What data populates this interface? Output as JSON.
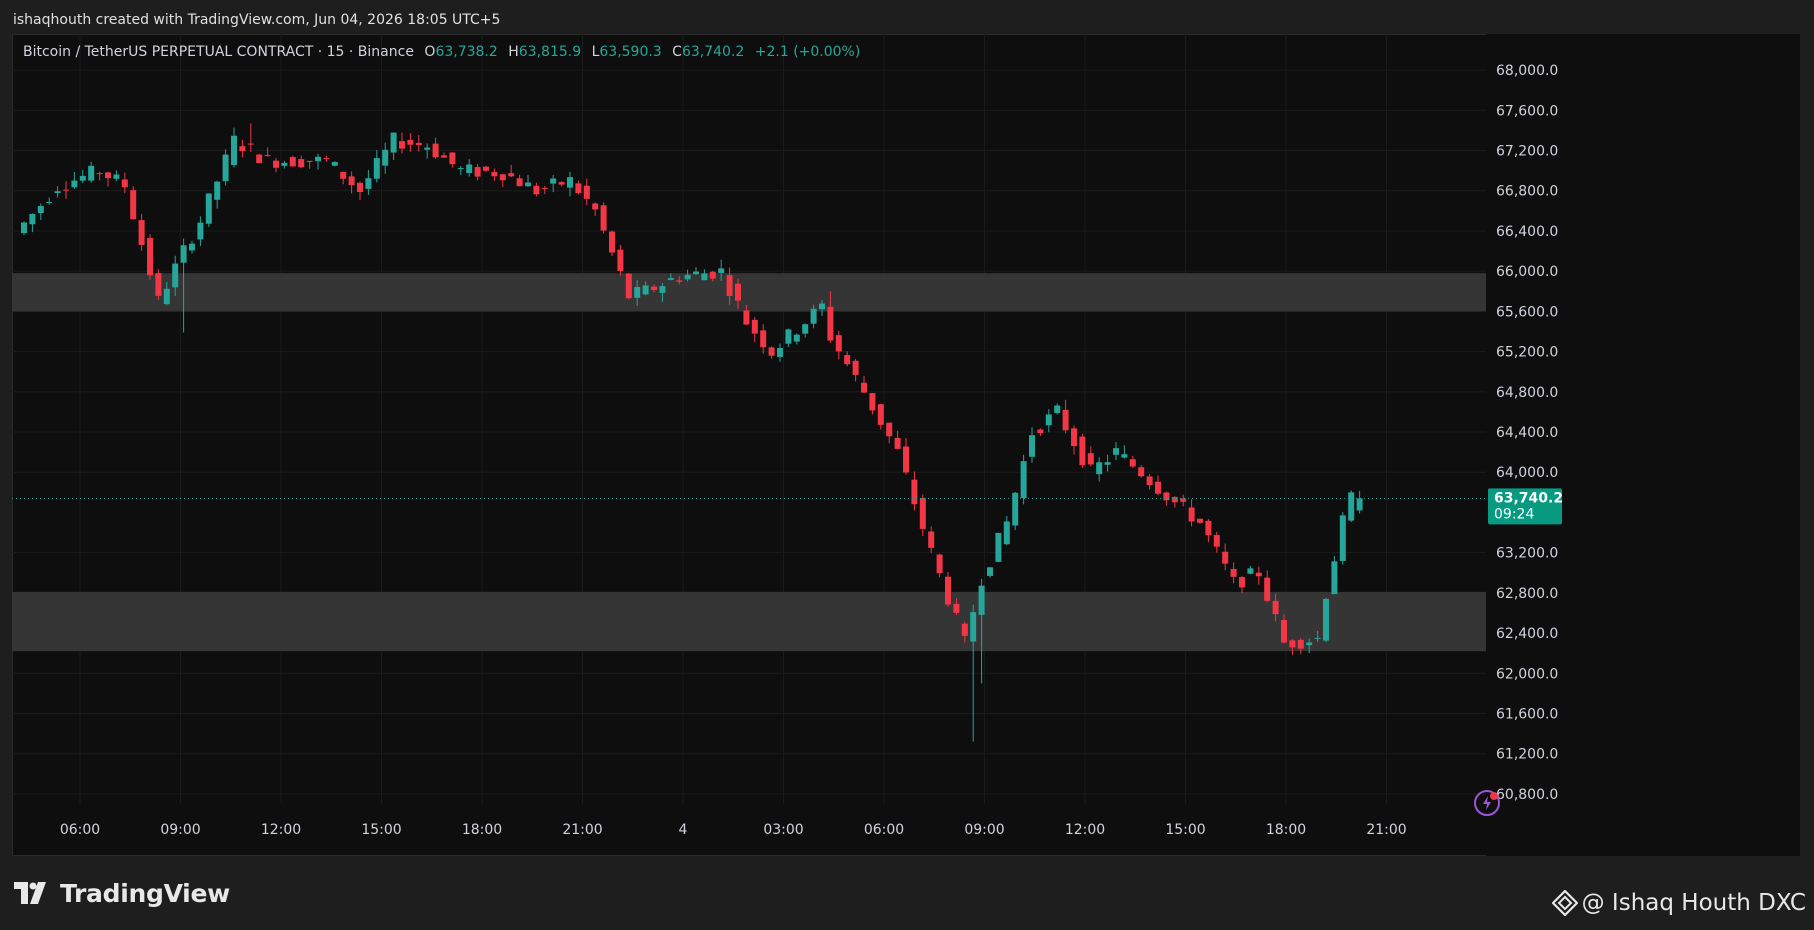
{
  "header": {
    "caption": "ishaqhouth created with TradingView.com, Jun 04, 2026 18:05 UTC+5"
  },
  "legend": {
    "symbol": "Bitcoin / TetherUS PERPETUAL CONTRACT · 15 · Binance",
    "o_label": "O",
    "o": "63,738.2",
    "h_label": "H",
    "h": "63,815.9",
    "l_label": "L",
    "l": "63,590.3",
    "c_label": "C",
    "c": "63,740.2",
    "change": "+2.1 (+0.00%)"
  },
  "price_badge": {
    "price": "63,740.2",
    "countdown": "09:24"
  },
  "footer": {
    "brand": "TradingView",
    "watermark": "@ Ishaq Houth DXC"
  },
  "colors": {
    "up": "#26a69a",
    "down": "#f23645",
    "zone": "#353535",
    "background": "#0e0e0e"
  },
  "chart_data": {
    "type": "candlestick",
    "interval_minutes": 15,
    "ylim": [
      60700,
      68200
    ],
    "y_ticks": [
      68000,
      67600,
      67200,
      66800,
      66400,
      66000,
      65600,
      65200,
      64800,
      64400,
      64000,
      63200,
      62800,
      62400,
      62000,
      61600,
      61200,
      60800
    ],
    "x_ticks": [
      "06:00",
      "09:00",
      "12:00",
      "15:00",
      "18:00",
      "21:00",
      "4",
      "03:00",
      "06:00",
      "09:00",
      "12:00",
      "15:00",
      "18:00",
      "21:00"
    ],
    "last_price": 63740.2,
    "zones": [
      {
        "from": 65600,
        "to": 65980
      },
      {
        "from": 62220,
        "to": 62810
      }
    ],
    "anchors": [
      {
        "t": 0,
        "p": 66380
      },
      {
        "t": 5,
        "p": 66850
      },
      {
        "t": 10,
        "p": 67000
      },
      {
        "t": 13,
        "p": 66850
      },
      {
        "t": 17,
        "p": 65700
      },
      {
        "t": 20,
        "p": 66200
      },
      {
        "t": 22,
        "p": 66500
      },
      {
        "t": 26,
        "p": 67300
      },
      {
        "t": 30,
        "p": 67100
      },
      {
        "t": 37,
        "p": 67100
      },
      {
        "t": 41,
        "p": 66800
      },
      {
        "t": 45,
        "p": 67300
      },
      {
        "t": 49,
        "p": 67250
      },
      {
        "t": 53,
        "p": 67000
      },
      {
        "t": 58,
        "p": 66980
      },
      {
        "t": 62,
        "p": 66800
      },
      {
        "t": 66,
        "p": 66900
      },
      {
        "t": 69,
        "p": 66600
      },
      {
        "t": 73,
        "p": 65750
      },
      {
        "t": 75,
        "p": 65800
      },
      {
        "t": 79,
        "p": 65950
      },
      {
        "t": 84,
        "p": 66000
      },
      {
        "t": 87,
        "p": 65500
      },
      {
        "t": 90,
        "p": 65200
      },
      {
        "t": 92,
        "p": 65350
      },
      {
        "t": 96,
        "p": 65650
      },
      {
        "t": 97,
        "p": 65350
      },
      {
        "t": 101,
        "p": 64800
      },
      {
        "t": 105,
        "p": 64200
      },
      {
        "t": 109,
        "p": 63200
      },
      {
        "t": 113,
        "p": 62300
      },
      {
        "t": 115,
        "p": 62950
      },
      {
        "t": 118,
        "p": 63500
      },
      {
        "t": 121,
        "p": 64400
      },
      {
        "t": 124,
        "p": 64600
      },
      {
        "t": 128,
        "p": 64000
      },
      {
        "t": 131,
        "p": 64200
      },
      {
        "t": 134,
        "p": 64000
      },
      {
        "t": 138,
        "p": 63700
      },
      {
        "t": 141,
        "p": 63500
      },
      {
        "t": 145,
        "p": 62900
      },
      {
        "t": 148,
        "p": 63000
      },
      {
        "t": 151,
        "p": 62300
      },
      {
        "t": 155,
        "p": 62350
      },
      {
        "t": 156,
        "p": 62800
      },
      {
        "t": 158,
        "p": 63500
      },
      {
        "t": 159,
        "p": 63740
      }
    ]
  }
}
